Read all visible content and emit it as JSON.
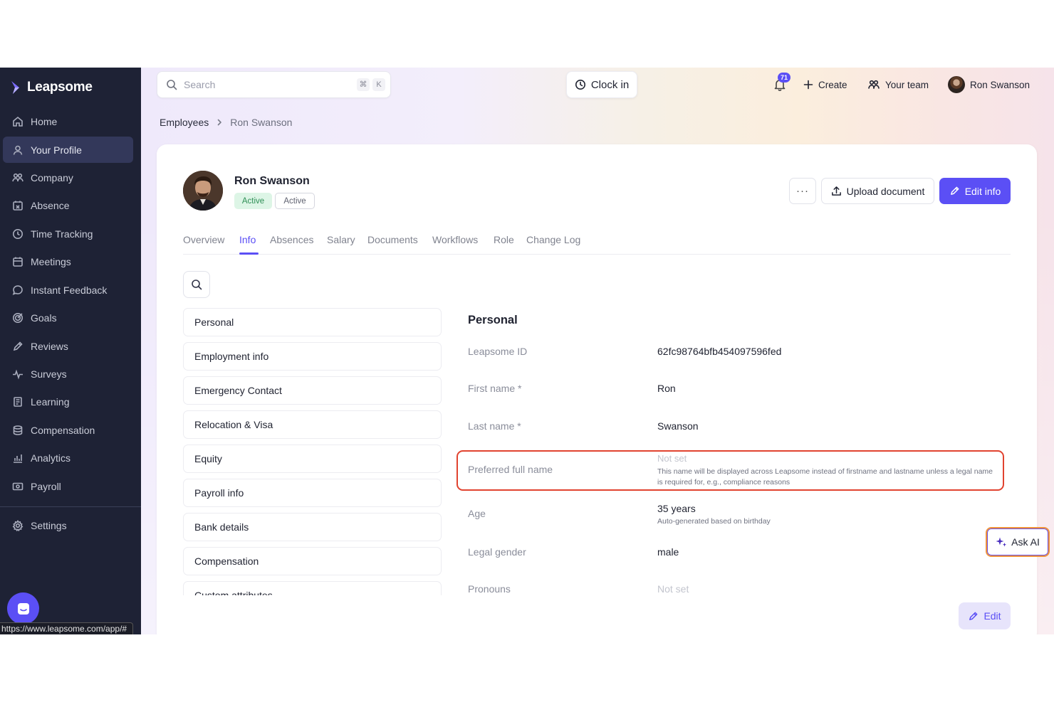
{
  "brand": {
    "name": "Leapsome"
  },
  "sidebar": {
    "items": [
      {
        "label": "Home",
        "icon": "home-icon"
      },
      {
        "label": "Your Profile",
        "icon": "user-icon",
        "active": true
      },
      {
        "label": "Company",
        "icon": "users-icon"
      },
      {
        "label": "Absence",
        "icon": "calendar-x-icon"
      },
      {
        "label": "Time Tracking",
        "icon": "clock-icon"
      },
      {
        "label": "Meetings",
        "icon": "calendar-icon"
      },
      {
        "label": "Instant Feedback",
        "icon": "chat-icon"
      },
      {
        "label": "Goals",
        "icon": "target-icon"
      },
      {
        "label": "Reviews",
        "icon": "pen-icon"
      },
      {
        "label": "Surveys",
        "icon": "pulse-icon"
      },
      {
        "label": "Learning",
        "icon": "book-icon"
      },
      {
        "label": "Compensation",
        "icon": "coins-icon"
      },
      {
        "label": "Analytics",
        "icon": "chart-icon"
      },
      {
        "label": "Payroll",
        "icon": "money-icon"
      }
    ],
    "settings": {
      "label": "Settings",
      "icon": "gear-icon"
    }
  },
  "status_bar": {
    "url": "https://www.leapsome.com/app/#"
  },
  "topbar": {
    "search_placeholder": "Search",
    "shortcut_mod": "⌘",
    "shortcut_key": "K",
    "clock_in": "Clock in",
    "notifications_count": "71",
    "create": "Create",
    "your_team": "Your team",
    "user_name": "Ron Swanson"
  },
  "breadcrumb": {
    "parent": "Employees",
    "current": "Ron Swanson"
  },
  "profile": {
    "name": "Ron Swanson",
    "badge_status": "Active",
    "badge_outline": "Active",
    "more": "···",
    "upload_document": "Upload document",
    "edit_info": "Edit info"
  },
  "tabs": [
    "Overview",
    "Info",
    "Absences",
    "Salary",
    "Documents",
    "Workflows",
    "Role",
    "Change Log"
  ],
  "active_tab": "Info",
  "sections": [
    "Personal",
    "Employment info",
    "Emergency Contact",
    "Relocation & Visa",
    "Equity",
    "Payroll info",
    "Bank details",
    "Compensation",
    "Custom attributes"
  ],
  "details": {
    "title": "Personal",
    "fields": [
      {
        "label": "Leapsome ID",
        "value": "62fc98764bfb454097596fed"
      },
      {
        "label": "First name *",
        "value": "Ron"
      },
      {
        "label": "Last name *",
        "value": "Swanson"
      },
      {
        "label": "Preferred full name",
        "value": "Not set",
        "note": "This name will be displayed across Leapsome instead of firstname and lastname unless a legal name is required for, e.g., compliance reasons"
      },
      {
        "label": "Age",
        "value": "35 years",
        "note": "Auto-generated based on birthday"
      },
      {
        "label": "Legal gender",
        "value": "male"
      },
      {
        "label": "Pronouns",
        "value": "Not set"
      }
    ]
  },
  "ask_ai": "Ask AI",
  "edit_button": "Edit",
  "colors": {
    "accent": "#5b4ff5",
    "sidebar": "#1e2235",
    "highlight": "#e1432f"
  }
}
